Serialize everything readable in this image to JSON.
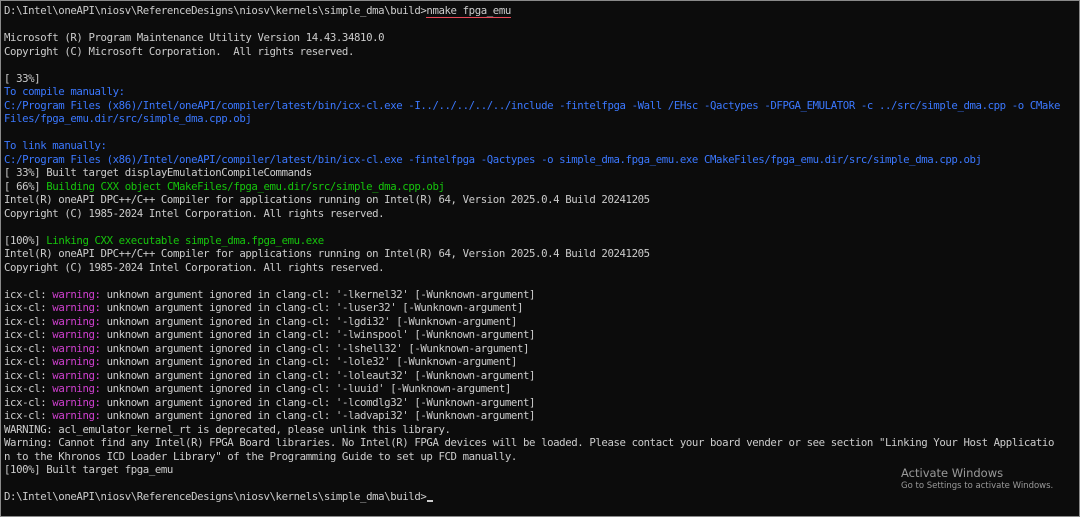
{
  "colors": {
    "background": "#0c0c0c",
    "text": "#cccccc",
    "info_blue": "#3b78ff",
    "progress_green": "#16c60c",
    "warning_magenta": "#d040d0",
    "highlight_underline": "#e74856"
  },
  "terminal": {
    "prompt": "D:\\Intel\\oneAPI\\niosv\\ReferenceDesigns\\niosv\\kernels\\simple_dma\\build>",
    "command": "nmake fpga_emu",
    "nmake_banner": [
      "Microsoft (R) Program Maintenance Utility Version 14.43.34810.0",
      "Copyright (C) Microsoft Corporation.  All rights reserved."
    ],
    "progress_33_a": "[ 33%]",
    "compile_manual_label": "To compile manually:",
    "compile_manual_cmd_1": "C:/Program Files (x86)/Intel/oneAPI/compiler/latest/bin/icx-cl.exe -I../../../../../include -fintelfpga -Wall /EHsc -Qactypes -DFPGA_EMULATOR -c ../src/simple_dma.cpp -o CMake",
    "compile_manual_cmd_2": "Files/fpga_emu.dir/src/simple_dma.cpp.obj",
    "link_manual_label": "To link manually:",
    "link_manual_cmd": "C:/Program Files (x86)/Intel/oneAPI/compiler/latest/bin/icx-cl.exe -fintelfpga -Qactypes -o simple_dma.fpga_emu.exe CMakeFiles/fpga_emu.dir/src/simple_dma.cpp.obj",
    "built_display": "[ 33%] Built target displayEmulationCompileCommands",
    "building_prefix": "[ 66%] ",
    "building_text": "Building CXX object CMakeFiles/fpga_emu.dir/src/simple_dma.cpp.obj",
    "intel_banner_1": "Intel(R) oneAPI DPC++/C++ Compiler for applications running on Intel(R) 64, Version 2025.0.4 Build 20241205",
    "intel_copyright_1": "Copyright (C) 1985-2024 Intel Corporation. All rights reserved.",
    "linking_prefix": "[100%] ",
    "linking_text": "Linking CXX executable simple_dma.fpga_emu.exe",
    "intel_banner_2": "Intel(R) oneAPI DPC++/C++ Compiler for applications running on Intel(R) 64, Version 2025.0.4 Build 20241205",
    "intel_copyright_2": "Copyright (C) 1985-2024 Intel Corporation. All rights reserved.",
    "warning_prefix": "icx-cl: ",
    "warning_word": "warning:",
    "warnings": [
      " unknown argument ignored in clang-cl: '-lkernel32' [-Wunknown-argument]",
      " unknown argument ignored in clang-cl: '-luser32' [-Wunknown-argument]",
      " unknown argument ignored in clang-cl: '-lgdi32' [-Wunknown-argument]",
      " unknown argument ignored in clang-cl: '-lwinspool' [-Wunknown-argument]",
      " unknown argument ignored in clang-cl: '-lshell32' [-Wunknown-argument]",
      " unknown argument ignored in clang-cl: '-lole32' [-Wunknown-argument]",
      " unknown argument ignored in clang-cl: '-loleaut32' [-Wunknown-argument]",
      " unknown argument ignored in clang-cl: '-luuid' [-Wunknown-argument]",
      " unknown argument ignored in clang-cl: '-lcomdlg32' [-Wunknown-argument]",
      " unknown argument ignored in clang-cl: '-ladvapi32' [-Wunknown-argument]"
    ],
    "acl_warning": "WARNING: acl_emulator_kernel_rt is deprecated, please unlink this library.",
    "fpga_warning_1": "Warning: Cannot find any Intel(R) FPGA Board libraries. No Intel(R) FPGA devices will be loaded. Please contact your board vender or see section \"Linking Your Host Applicatio",
    "fpga_warning_2": "n to the Khronos ICD Loader Library\" of the Programming Guide to set up FCD manually.",
    "built_fpga_emu": "[100%] Built target fpga_emu"
  },
  "watermark": {
    "title": "Activate Windows",
    "subtitle": "Go to Settings to activate Windows."
  }
}
